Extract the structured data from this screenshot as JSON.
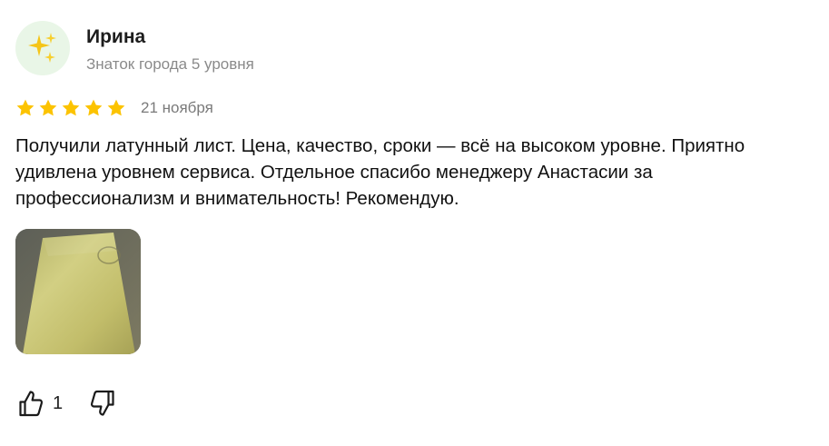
{
  "author": {
    "name": "Ирина",
    "level": "Знаток города 5 уровня",
    "avatar_icon": "sparkles-icon"
  },
  "review": {
    "rating": 5,
    "rating_max": 5,
    "star_color": "#fcc300",
    "date": "21 ноября",
    "text": "Получили латунный лист. Цена, качество, сроки — всё на высоком уровне. Приятно удивлена уровнем сервиса. Отдельное спасибо менеджеру Анастасии за профессионализм и внимательность! Рекомендую.",
    "photos_count": 1
  },
  "reactions": {
    "likes": "1",
    "like_icon": "thumbs-up-icon",
    "dislike_icon": "thumbs-down-icon"
  },
  "colors": {
    "avatar_bg": "#e9f6e7",
    "sparkle": "#f5c518",
    "muted_text": "#8a8a8a"
  }
}
